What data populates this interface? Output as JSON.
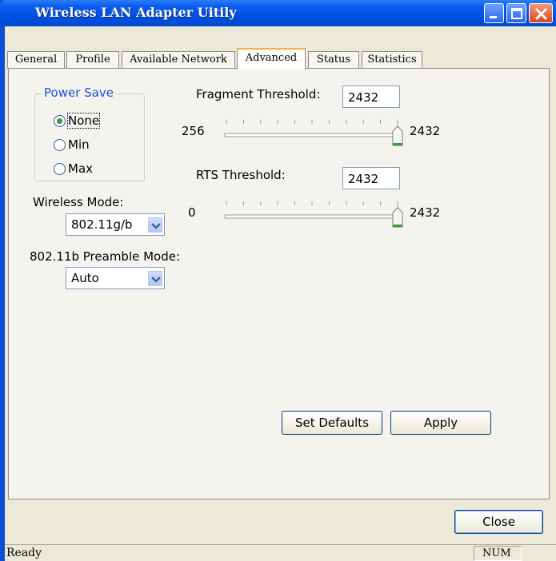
{
  "window": {
    "title": "Wireless LAN Adapter Uitily"
  },
  "tabs": [
    {
      "label": "General"
    },
    {
      "label": "Profile"
    },
    {
      "label": "Available Network"
    },
    {
      "label": "Advanced",
      "active": true
    },
    {
      "label": "Status"
    },
    {
      "label": "Statistics"
    }
  ],
  "power_save": {
    "legend": "Power Save",
    "options": [
      {
        "label": "None",
        "checked": true
      },
      {
        "label": "Min",
        "checked": false
      },
      {
        "label": "Max",
        "checked": false
      }
    ]
  },
  "wireless_mode": {
    "label": "Wireless Mode:",
    "value": "802.11g/b"
  },
  "preamble_mode": {
    "label": "802.11b Preamble Mode:",
    "value": "Auto"
  },
  "fragment_threshold": {
    "label": "Fragment Threshold:",
    "value": "2432",
    "min": "256",
    "max": "2432",
    "level": 1.0
  },
  "rts_threshold": {
    "label": "RTS Threshold:",
    "value": "2432",
    "min": "0",
    "max": "2432",
    "level": 1.0
  },
  "buttons": {
    "set_defaults": "Set Defaults",
    "apply": "Apply",
    "close": "Close"
  },
  "status": {
    "text": "Ready",
    "num": "NUM"
  },
  "colors": {
    "title_bar": "#0a4fd6",
    "group_legend": "#1e50e0",
    "slider_thumb_accent": "#3a9a3a"
  }
}
